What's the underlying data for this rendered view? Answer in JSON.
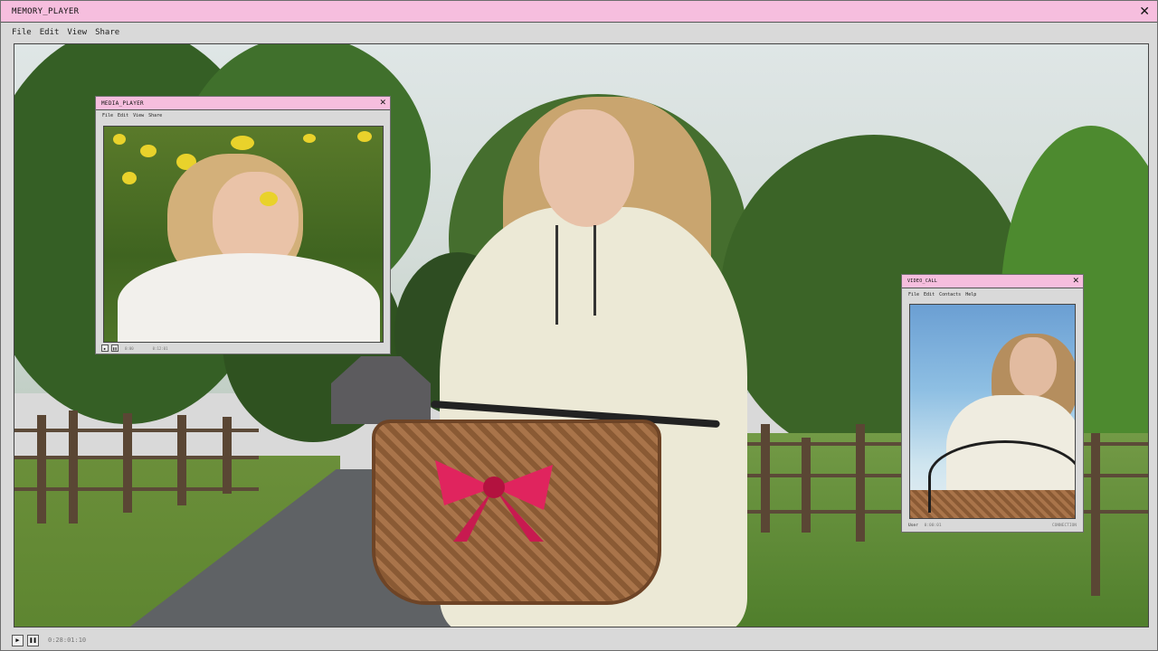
{
  "main_window": {
    "title": "MEMORY_PLAYER",
    "menu": [
      "File",
      "Edit",
      "View",
      "Share"
    ],
    "status_text": "0:28:01:10",
    "controls": {
      "play_icon": "play-icon",
      "pause_icon": "pause-icon",
      "close_icon": "close-icon"
    }
  },
  "media_player": {
    "title": "MEDIA_PLAYER",
    "menu": [
      "File",
      "Edit",
      "View",
      "Share"
    ],
    "time": "0:00",
    "status_text": "0:12:01"
  },
  "video_call": {
    "title": "VIDEO_CALL",
    "menu": [
      "File",
      "Edit",
      "Contacts",
      "Help"
    ],
    "user_label": "User",
    "user_status": "0:00:01",
    "connection_text": "CONNECTION"
  },
  "colors": {
    "titlebar": "#f6bede",
    "chrome": "#d9d9d9"
  }
}
